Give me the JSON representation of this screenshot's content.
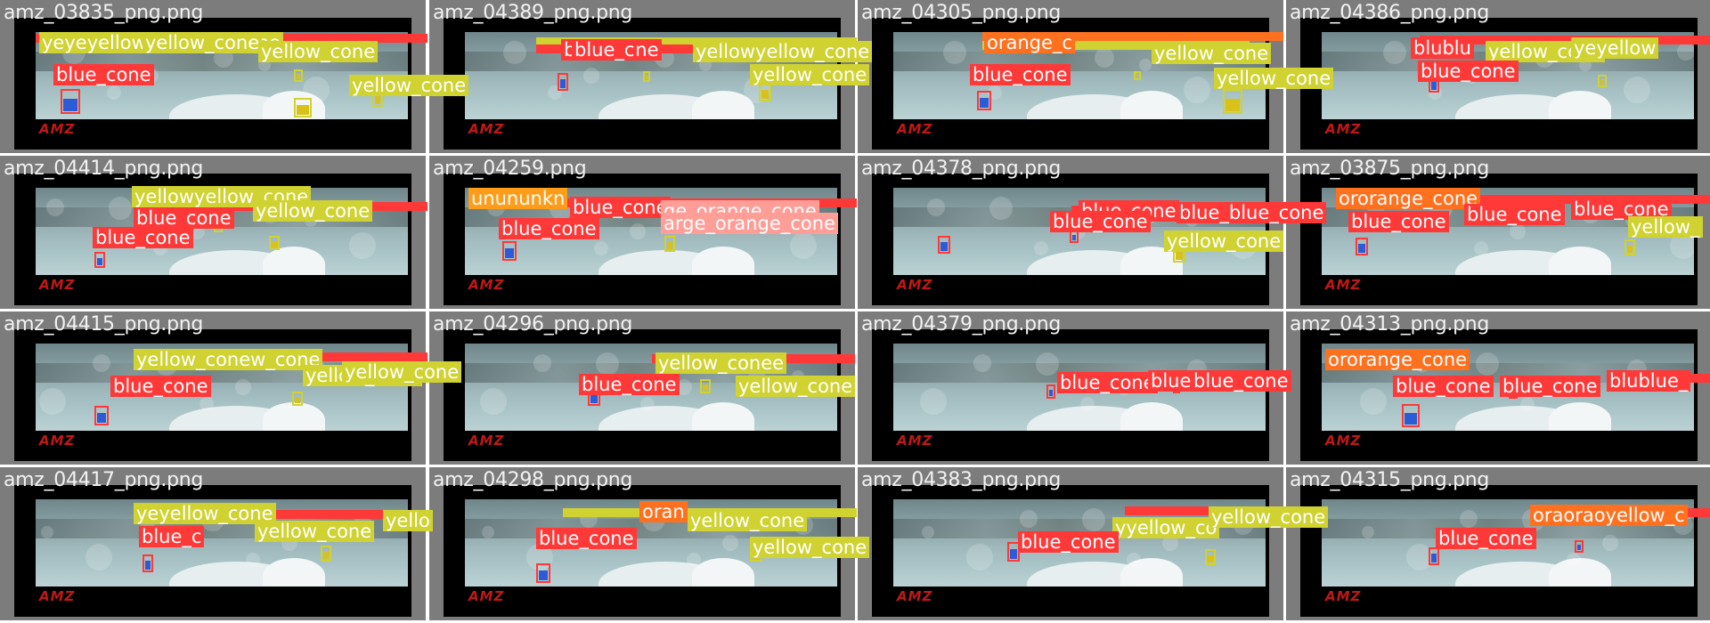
{
  "colors": {
    "blue_cone": "#ff3838",
    "yellow_cone": "#cfd231",
    "orange_cone": "#ff701f",
    "unknown_cone": "#ff9d1a",
    "large_orange_cone": "#ff9d97",
    "tile_background": "#7c7c7c",
    "frame": "#000000",
    "logo": "#c01818"
  },
  "tiles": [
    {
      "title": "amz_03835_png.png",
      "logo": "AMZ",
      "labels": [
        {
          "text": "yeyeyellow_cyellow_cone",
          "cls": "yellow"
        },
        {
          "text": "yellow_cone",
          "cls": "yellow"
        },
        {
          "text": "yellow_cone",
          "cls": "yellow"
        },
        {
          "text": "blue_cone",
          "cls": "blue"
        },
        {
          "text": "yellow_cone",
          "cls": "yellow"
        }
      ]
    },
    {
      "title": "amz_04389_png.png",
      "logo": "AMZ",
      "labels": [
        {
          "text": "blue_cone",
          "cls": "blue"
        },
        {
          "text": "blue_c",
          "cls": "blue"
        },
        {
          "text": "yellowyellow_cone",
          "cls": "yellow"
        },
        {
          "text": "yellow_cone",
          "cls": "yellow"
        }
      ]
    },
    {
      "title": "amz_04305_png.png",
      "logo": "AMZ",
      "labels": [
        {
          "text": "orange_c",
          "cls": "orange"
        },
        {
          "text": "yellow_cone",
          "cls": "yellow"
        },
        {
          "text": "blue_cone",
          "cls": "blue"
        },
        {
          "text": "yellow_cone",
          "cls": "yellow"
        }
      ]
    },
    {
      "title": "amz_04386_png.png",
      "logo": "AMZ",
      "labels": [
        {
          "text": "blublu",
          "cls": "blue"
        },
        {
          "text": "yellow_cone",
          "cls": "yellow"
        },
        {
          "text": "yeyellow",
          "cls": "yellow"
        },
        {
          "text": "blue_cone",
          "cls": "blue"
        }
      ]
    },
    {
      "title": "amz_04414_png.png",
      "logo": "AMZ",
      "labels": [
        {
          "text": "yellowyellow_cone",
          "cls": "yellow"
        },
        {
          "text": "blue_cone",
          "cls": "blue"
        },
        {
          "text": "yellow_cone",
          "cls": "yellow"
        },
        {
          "text": "blue_cone",
          "cls": "blue"
        }
      ]
    },
    {
      "title": "amz_04259.png",
      "logo": "AMZ",
      "labels": [
        {
          "text": "unununkn",
          "cls": "unknown"
        },
        {
          "text": "blue_cone",
          "cls": "blue"
        },
        {
          "text": "ge_orange_cone",
          "cls": "large"
        },
        {
          "text": "blue_cone",
          "cls": "blue"
        },
        {
          "text": "arge_orange_cone",
          "cls": "large"
        }
      ]
    },
    {
      "title": "amz_04378_png.png",
      "logo": "AMZ",
      "labels": [
        {
          "text": "blue_cone",
          "cls": "blue"
        },
        {
          "text": "blue_cone",
          "cls": "blue"
        },
        {
          "text": "blue_blue_cone",
          "cls": "blue"
        },
        {
          "text": "yellow_cone",
          "cls": "yellow"
        }
      ]
    },
    {
      "title": "amz_03875_png.png",
      "logo": "AMZ",
      "labels": [
        {
          "text": "ororange_cone",
          "cls": "orange"
        },
        {
          "text": "blue_cone",
          "cls": "blue"
        },
        {
          "text": "blue_cone",
          "cls": "blue"
        },
        {
          "text": "blue_cone",
          "cls": "blue"
        },
        {
          "text": "yellow_",
          "cls": "yellow"
        }
      ]
    },
    {
      "title": "amz_04415_png.png",
      "logo": "AMZ",
      "labels": [
        {
          "text": "yellow_conew_cone",
          "cls": "yellow"
        },
        {
          "text": "blue_cone",
          "cls": "blue"
        },
        {
          "text": "yellow_cone",
          "cls": "yellow"
        },
        {
          "text": "yellow_cone",
          "cls": "yellow"
        }
      ]
    },
    {
      "title": "amz_04296_png.png",
      "logo": "AMZ",
      "labels": [
        {
          "text": "yellow_conee",
          "cls": "yellow"
        },
        {
          "text": "blue_cone",
          "cls": "blue"
        },
        {
          "text": "yellow_cone",
          "cls": "yellow"
        }
      ]
    },
    {
      "title": "amz_04379_png.png",
      "logo": "AMZ",
      "labels": [
        {
          "text": "blue_cone",
          "cls": "blue"
        },
        {
          "text": "blue_",
          "cls": "blue"
        },
        {
          "text": "blue_cone",
          "cls": "blue"
        }
      ]
    },
    {
      "title": "amz_04313_png.png",
      "logo": "AMZ",
      "labels": [
        {
          "text": "ororange_cone",
          "cls": "orange"
        },
        {
          "text": "blue_cone",
          "cls": "blue"
        },
        {
          "text": "blue_cone",
          "cls": "blue"
        },
        {
          "text": "blublue_",
          "cls": "blue"
        }
      ]
    },
    {
      "title": "amz_04417_png.png",
      "logo": "AMZ",
      "labels": [
        {
          "text": "yeyellow_cone",
          "cls": "yellow"
        },
        {
          "text": "blue_c",
          "cls": "blue"
        },
        {
          "text": "yellow_cone",
          "cls": "yellow"
        },
        {
          "text": "yello",
          "cls": "yellow"
        }
      ]
    },
    {
      "title": "amz_04298_png.png",
      "logo": "AMZ",
      "labels": [
        {
          "text": "oran",
          "cls": "orange"
        },
        {
          "text": "yellow_cone",
          "cls": "yellow"
        },
        {
          "text": "blue_cone",
          "cls": "blue"
        },
        {
          "text": "yellow_cone",
          "cls": "yellow"
        }
      ]
    },
    {
      "title": "amz_04383_png.png",
      "logo": "AMZ",
      "labels": [
        {
          "text": "yyellow_co",
          "cls": "yellow"
        },
        {
          "text": "yellow_cone",
          "cls": "yellow"
        },
        {
          "text": "blue_cone",
          "cls": "blue"
        }
      ]
    },
    {
      "title": "amz_04315_png.png",
      "logo": "AMZ",
      "labels": [
        {
          "text": "oraoraoyellow_c",
          "cls": "orange"
        },
        {
          "text": "blue_cone",
          "cls": "blue"
        }
      ]
    }
  ]
}
